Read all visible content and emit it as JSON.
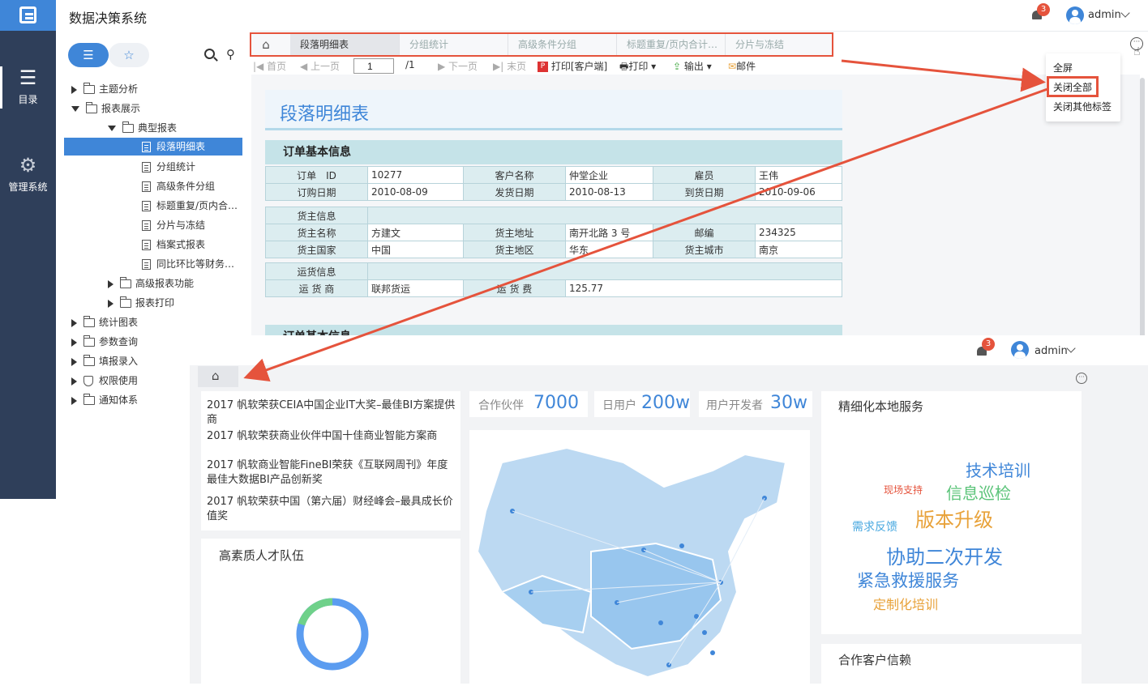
{
  "app": {
    "title": "数据决策系统"
  },
  "rail": {
    "items": [
      {
        "label": "目录"
      },
      {
        "label": "管理系统"
      }
    ]
  },
  "header": {
    "notification_count": "3",
    "user": "admin"
  },
  "sidebar": {
    "tree": [
      {
        "label": "主题分析"
      },
      {
        "label": "报表展示"
      },
      {
        "label": "典型报表"
      },
      {
        "label": "段落明细表"
      },
      {
        "label": "分组统计"
      },
      {
        "label": "高级条件分组"
      },
      {
        "label": "标题重复/页内合…"
      },
      {
        "label": "分片与冻结"
      },
      {
        "label": "档案式报表"
      },
      {
        "label": "同比环比等财务…"
      },
      {
        "label": "高级报表功能"
      },
      {
        "label": "报表打印"
      },
      {
        "label": "统计图表"
      },
      {
        "label": "参数查询"
      },
      {
        "label": "填报录入"
      },
      {
        "label": "权限使用"
      },
      {
        "label": "通知体系"
      }
    ]
  },
  "tabs": [
    "段落明细表",
    "分组统计",
    "高级条件分组",
    "标题重复/页内合计…",
    "分片与冻结"
  ],
  "toolbar": {
    "first": "首页",
    "prev": "上一页",
    "page": "1",
    "total": "/1",
    "next": "下一页",
    "last": "末页",
    "print_client": "打印[客户端]",
    "print": "打印",
    "export": "输出",
    "mail": "邮件"
  },
  "menu": {
    "items": [
      "全屏",
      "关闭全部",
      "关闭其他标签"
    ]
  },
  "report": {
    "title": "段落明细表",
    "section1": "订单基本信息",
    "r1": [
      "订单　ID",
      "10277",
      "客户名称",
      "仲堂企业",
      "雇员",
      "王伟"
    ],
    "r2": [
      "订购日期",
      "2010-08-09",
      "发货日期",
      "2010-08-13",
      "到货日期",
      "2010-09-06"
    ],
    "cargo_title": "货主信息",
    "r3": [
      "货主名称",
      "方建文",
      "货主地址",
      "南开北路 3 号",
      "邮编",
      "234325"
    ],
    "r4": [
      "货主国家",
      "中国",
      "货主地区",
      "华东",
      "货主城市",
      "南京"
    ],
    "ship_title": "运货信息",
    "r5": [
      "运 货 商",
      "联邦货运",
      "运 货 费",
      "125.77"
    ],
    "section2_partial": "订单基本信息"
  },
  "dashboard": {
    "notification_count": "3",
    "user": "admin",
    "news": [
      "2017 帆软荣获CEIA中国企业IT大奖–最佳BI方案提供商",
      "2017 帆软荣获商业伙伴中国十佳商业智能方案商",
      "2017 帆软商业智能FineBI荣获《互联网周刊》年度最佳大数据BI产品创新奖",
      "2017 帆软荣获中国（第六届）财经峰会–最具成长价值奖"
    ],
    "kpis": [
      {
        "label": "合作伙伴",
        "value": "7000"
      },
      {
        "label": "日用户",
        "value": "200w"
      },
      {
        "label": "用户开发者",
        "value": "30w"
      }
    ],
    "talent_title": "高素质人才队伍",
    "service_title": "精细化本地服务",
    "words": [
      "技术培训",
      "现场支持",
      "信息巡检",
      "需求反馈",
      "版本升级",
      "协助二次开发",
      "紧急救援服务",
      "定制化培训"
    ],
    "clients_title": "合作客户信赖"
  },
  "colors": {
    "accent": "#3f86d8",
    "rail": "#2f3f5a",
    "highlight": "#e5533c"
  }
}
